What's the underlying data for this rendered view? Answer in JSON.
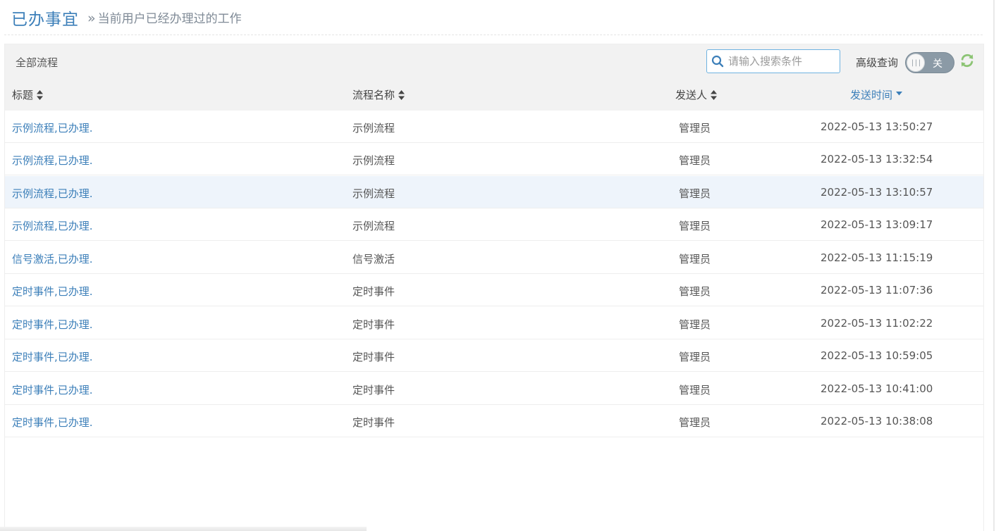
{
  "header": {
    "title": "已办事宜",
    "subtitle_prefix": "»",
    "subtitle": "当前用户已经办理过的工作"
  },
  "toolbar": {
    "title": "全部流程",
    "search_placeholder": "请输入搜索条件",
    "advanced_label": "高级查询",
    "advanced_toggle_state": "关"
  },
  "columns": [
    {
      "label": "标题",
      "sort": "none"
    },
    {
      "label": "流程名称",
      "sort": "none"
    },
    {
      "label": "发送人",
      "sort": "none"
    },
    {
      "label": "发送时间",
      "sort": "desc"
    }
  ],
  "rows": [
    {
      "title": "示例流程,已办理.",
      "flow": "示例流程",
      "sender": "管理员",
      "time": "2022-05-13 13:50:27"
    },
    {
      "title": "示例流程,已办理.",
      "flow": "示例流程",
      "sender": "管理员",
      "time": "2022-05-13 13:32:54"
    },
    {
      "title": "示例流程,已办理.",
      "flow": "示例流程",
      "sender": "管理员",
      "time": "2022-05-13 13:10:57"
    },
    {
      "title": "示例流程,已办理.",
      "flow": "示例流程",
      "sender": "管理员",
      "time": "2022-05-13 13:09:17"
    },
    {
      "title": "信号激活,已办理.",
      "flow": "信号激活",
      "sender": "管理员",
      "time": "2022-05-13 11:15:19"
    },
    {
      "title": "定时事件,已办理.",
      "flow": "定时事件",
      "sender": "管理员",
      "time": "2022-05-13 11:07:36"
    },
    {
      "title": "定时事件,已办理.",
      "flow": "定时事件",
      "sender": "管理员",
      "time": "2022-05-13 11:02:22"
    },
    {
      "title": "定时事件,已办理.",
      "flow": "定时事件",
      "sender": "管理员",
      "time": "2022-05-13 10:59:05"
    },
    {
      "title": "定时事件,已办理.",
      "flow": "定时事件",
      "sender": "管理员",
      "time": "2022-05-13 10:41:00"
    },
    {
      "title": "定时事件,已办理.",
      "flow": "定时事件",
      "sender": "管理员",
      "time": "2022-05-13 10:38:08"
    }
  ],
  "colors": {
    "accent": "#3c7fb9",
    "search_border": "#6fb3e0",
    "toggle_bg": "#8b9aa6",
    "refresh": "#8cc474",
    "row_hover": "#eef4fb"
  },
  "icons": {
    "search": "search-icon",
    "refresh": "refresh-icon",
    "sort": "sort-both-icon",
    "sort_desc": "sort-down-icon"
  }
}
